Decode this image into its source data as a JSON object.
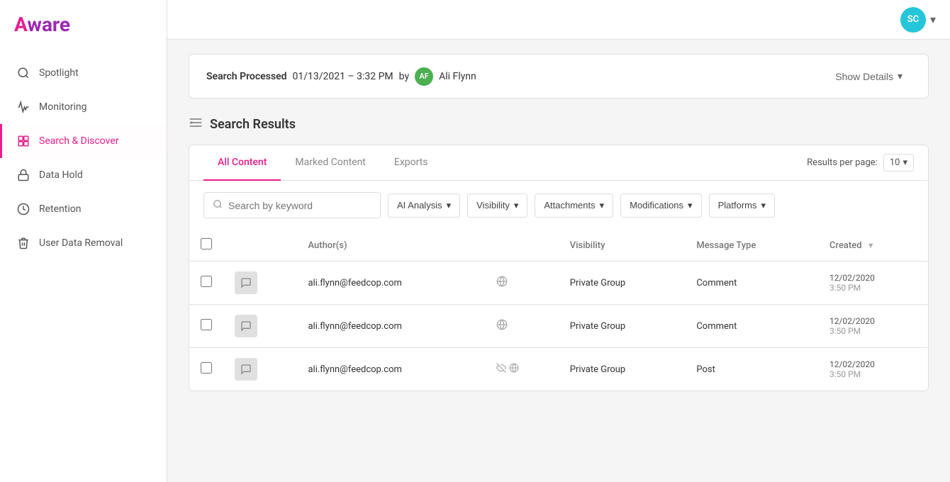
{
  "app": {
    "name_part1": "A",
    "name_part2": "ware"
  },
  "topbar": {
    "avatar_initials": "SC",
    "avatar_bg": "#26c6da"
  },
  "sidebar": {
    "items": [
      {
        "id": "spotlight",
        "label": "Spotlight",
        "icon": "spotlight"
      },
      {
        "id": "monitoring",
        "label": "Monitoring",
        "icon": "monitoring"
      },
      {
        "id": "search-discover",
        "label": "Search & Discover",
        "icon": "search",
        "active": true
      },
      {
        "id": "data-hold",
        "label": "Data Hold",
        "icon": "data-hold"
      },
      {
        "id": "retention",
        "label": "Retention",
        "icon": "retention"
      },
      {
        "id": "user-data-removal",
        "label": "User Data Removal",
        "icon": "user-data-removal"
      }
    ]
  },
  "banner": {
    "label": "Search Processed",
    "datetime": "01/13/2021 – 3:32 PM",
    "by": "by",
    "user_initials": "AF",
    "user_name": "Ali Flynn",
    "user_avatar_bg": "#4caf50",
    "show_details_label": "Show Details"
  },
  "section": {
    "title": "Search Results",
    "icon": "search-results"
  },
  "tabs": [
    {
      "id": "all-content",
      "label": "All Content",
      "active": true
    },
    {
      "id": "marked-content",
      "label": "Marked Content",
      "active": false
    },
    {
      "id": "exports",
      "label": "Exports",
      "active": false
    }
  ],
  "results_per_page": {
    "label": "Results per page:",
    "value": "10"
  },
  "filters": {
    "search_placeholder": "Search by keyword",
    "ai_analysis": "AI Analysis",
    "visibility": "Visibility",
    "attachments": "Attachments",
    "modifications": "Modifications",
    "platforms": "Platforms"
  },
  "table": {
    "columns": [
      {
        "id": "select",
        "label": ""
      },
      {
        "id": "icon",
        "label": ""
      },
      {
        "id": "author",
        "label": "Author(s)"
      },
      {
        "id": "visibility_icon",
        "label": ""
      },
      {
        "id": "visibility",
        "label": "Visibility"
      },
      {
        "id": "message_type",
        "label": "Message Type"
      },
      {
        "id": "created",
        "label": "Created",
        "sortable": true
      }
    ],
    "rows": [
      {
        "id": 1,
        "author": "ali.flynn@feedcop.com",
        "visibility": "Private Group",
        "message_type": "Comment",
        "created_date": "12/02/2020",
        "created_time": "3:50 PM",
        "has_extra_icon": false
      },
      {
        "id": 2,
        "author": "ali.flynn@feedcop.com",
        "visibility": "Private Group",
        "message_type": "Comment",
        "created_date": "12/02/2020",
        "created_time": "3:50 PM",
        "has_extra_icon": false
      },
      {
        "id": 3,
        "author": "ali.flynn@feedcop.com",
        "visibility": "Private Group",
        "message_type": "Post",
        "created_date": "12/02/2020",
        "created_time": "3:50 PM",
        "has_extra_icon": true
      }
    ]
  }
}
